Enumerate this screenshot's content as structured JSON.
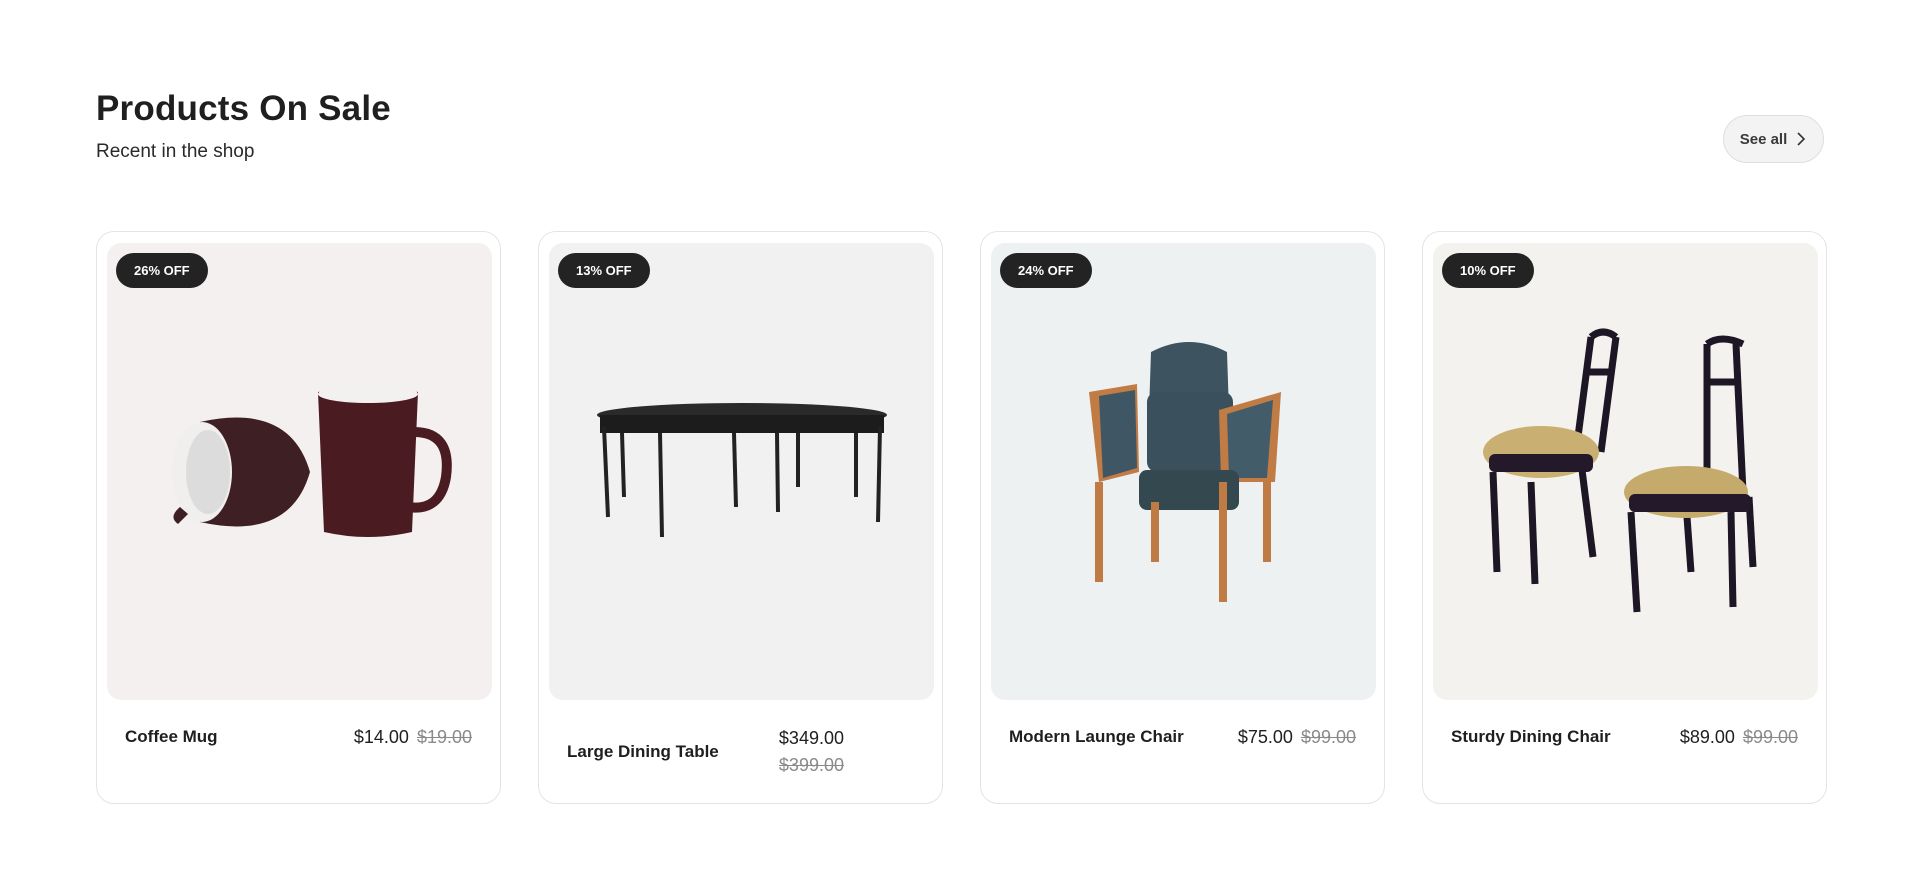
{
  "section": {
    "title": "Products On Sale",
    "subtitle": "Recent in the shop",
    "see_all_label": "See all"
  },
  "products": [
    {
      "badge": "26% OFF",
      "name": "Coffee Mug",
      "price": "$14.00",
      "old_price": "$19.00",
      "bg": "#f4f0f0"
    },
    {
      "badge": "13% OFF",
      "name": "Large Dining Table",
      "price": "$349.00",
      "old_price": "$399.00",
      "bg": "#f1f1f1"
    },
    {
      "badge": "24% OFF",
      "name": "Modern Launge Chair",
      "price": "$75.00",
      "old_price": "$99.00",
      "bg": "#eef1f2"
    },
    {
      "badge": "10% OFF",
      "name": "Sturdy Dining Chair",
      "price": "$89.00",
      "old_price": "$99.00",
      "bg": "#f4f2ee"
    }
  ],
  "icons": {
    "see_all": "chevron-right-icon"
  }
}
